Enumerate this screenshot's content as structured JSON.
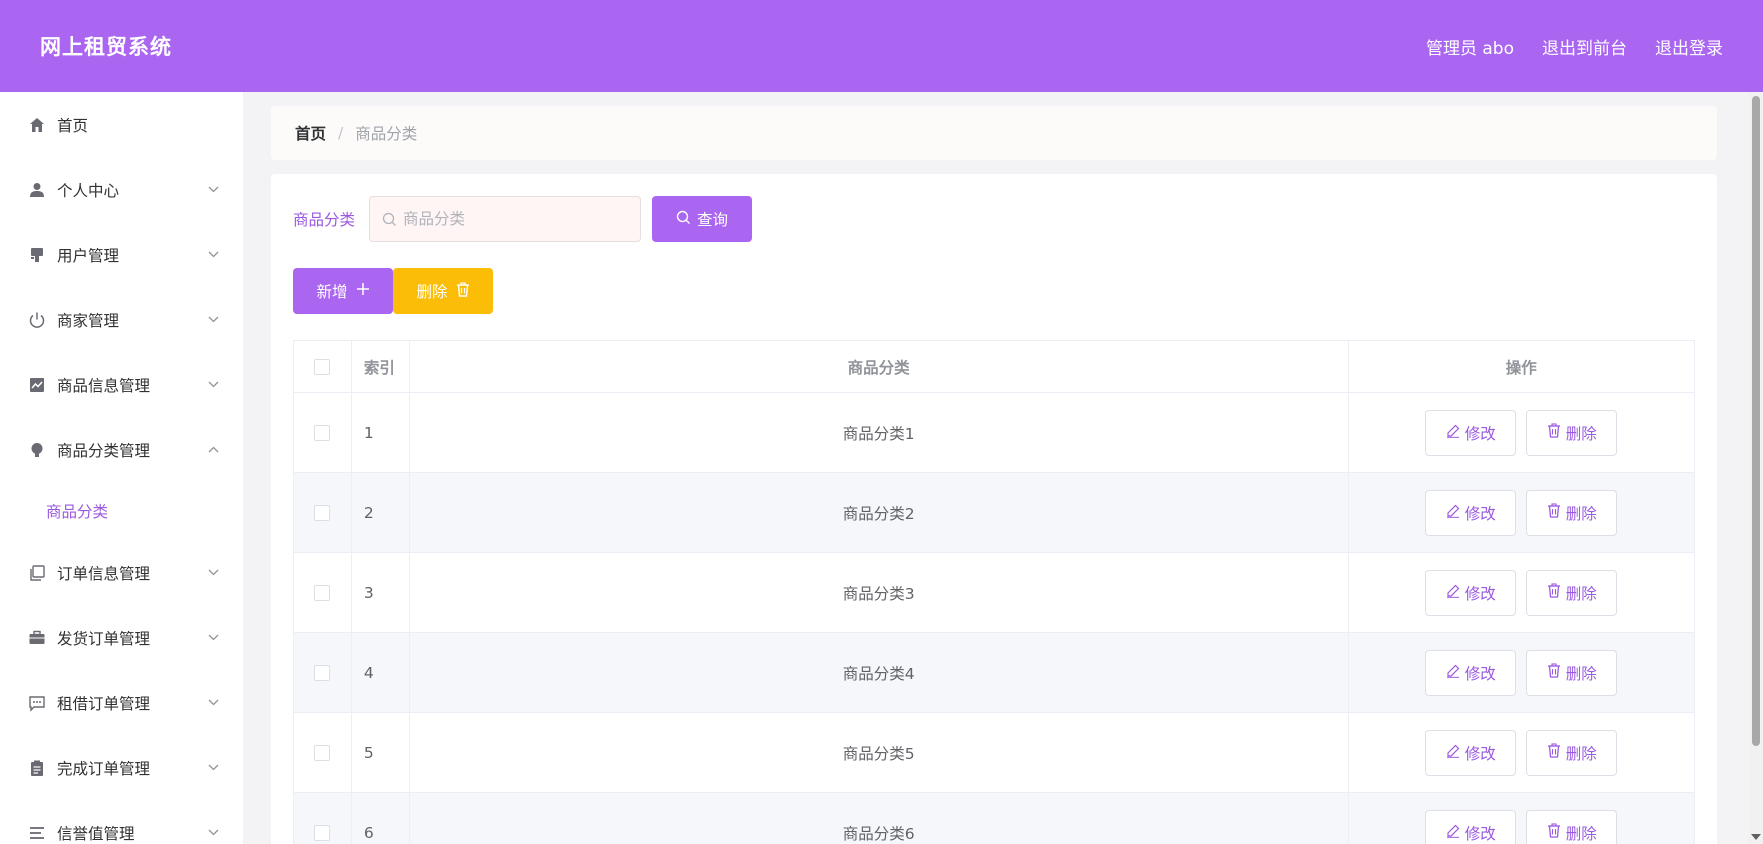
{
  "header": {
    "title": "网上租贸系统",
    "admin_label": "管理员 abo",
    "exit_front_label": "退出到前台",
    "logout_label": "退出登录"
  },
  "sidebar": {
    "items": [
      {
        "label": "首页",
        "icon": "home-icon",
        "expandable": false
      },
      {
        "label": "个人中心",
        "icon": "user-icon",
        "expandable": true
      },
      {
        "label": "用户管理",
        "icon": "stamp-icon",
        "expandable": true
      },
      {
        "label": "商家管理",
        "icon": "power-icon",
        "expandable": true
      },
      {
        "label": "商品信息管理",
        "icon": "chart-icon",
        "expandable": true
      },
      {
        "label": "商品分类管理",
        "icon": "bulb-icon",
        "expandable": true,
        "expanded": true
      },
      {
        "label": "订单信息管理",
        "icon": "copy-icon",
        "expandable": true
      },
      {
        "label": "发货订单管理",
        "icon": "briefcase-icon",
        "expandable": true
      },
      {
        "label": "租借订单管理",
        "icon": "message-icon",
        "expandable": true
      },
      {
        "label": "完成订单管理",
        "icon": "clipboard-icon",
        "expandable": true
      },
      {
        "label": "信誉值管理",
        "icon": "list-icon",
        "expandable": true
      }
    ],
    "submenu_active": "商品分类"
  },
  "breadcrumb": {
    "home": "首页",
    "separator": "/",
    "current": "商品分类"
  },
  "search": {
    "label": "商品分类",
    "placeholder": "商品分类",
    "value": "",
    "query_label": "查询"
  },
  "actions": {
    "add_label": "新增",
    "delete_label": "删除"
  },
  "table": {
    "columns": [
      "",
      "索引",
      "商品分类",
      "操作"
    ],
    "rows": [
      {
        "index": "1",
        "category": "商品分类1"
      },
      {
        "index": "2",
        "category": "商品分类2"
      },
      {
        "index": "3",
        "category": "商品分类3"
      },
      {
        "index": "4",
        "category": "商品分类4"
      },
      {
        "index": "5",
        "category": "商品分类5"
      },
      {
        "index": "6",
        "category": "商品分类6"
      }
    ],
    "edit_label": "修改",
    "delete_label": "删除"
  },
  "colors": {
    "primary": "#ab66f1",
    "warning": "#fbbd08",
    "accent_text": "#9b59e0"
  }
}
